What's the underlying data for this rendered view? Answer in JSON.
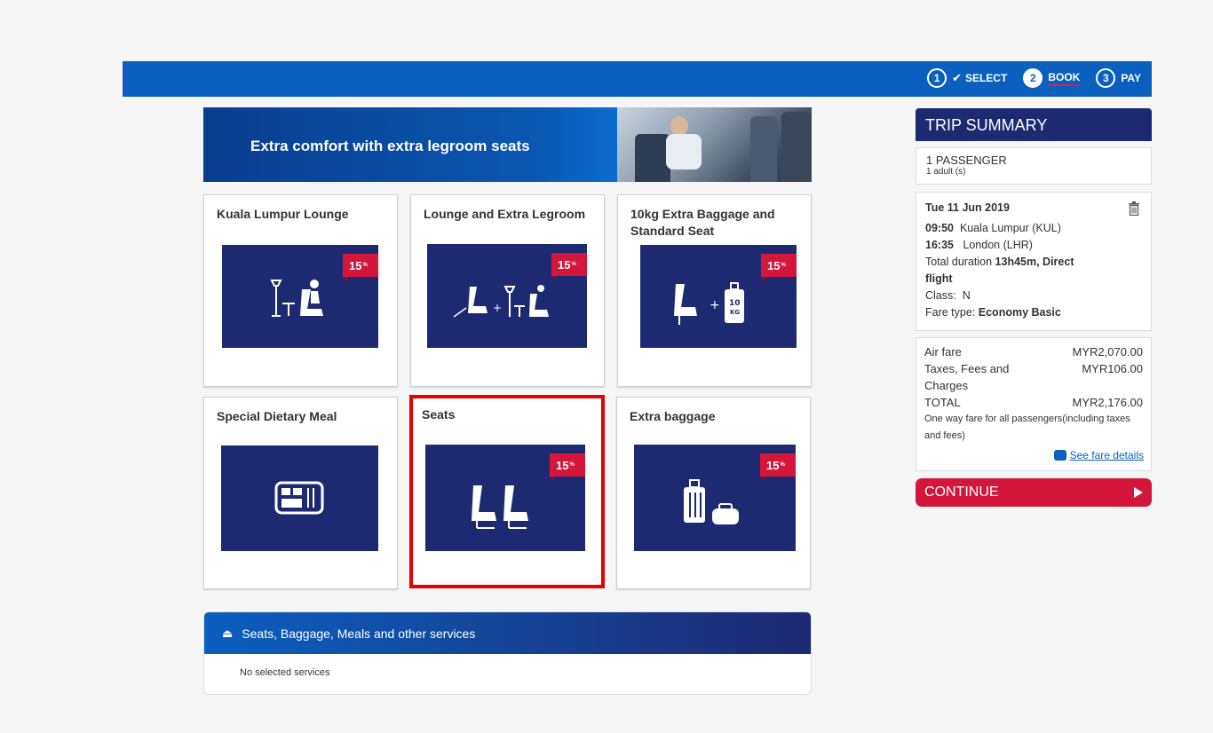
{
  "steps": [
    {
      "num": "1",
      "label": "SELECT",
      "done": true
    },
    {
      "num": "2",
      "label": "BOOK",
      "active": true
    },
    {
      "num": "3",
      "label": "PAY"
    }
  ],
  "banner": {
    "text": "Extra comfort with extra legroom seats"
  },
  "cards": [
    {
      "title": "Kuala Lumpur Lounge",
      "badge": "15",
      "icon": "lounge-icon"
    },
    {
      "title": "Lounge and Extra Legroom",
      "badge": "15",
      "icon": "lounge-legroom-icon"
    },
    {
      "title": "10kg Extra Baggage and Standard Seat",
      "badge": "15",
      "icon": "seat-baggage-icon",
      "bag_weight": "10",
      "bag_unit": "KG"
    },
    {
      "title": "Special Dietary Meal",
      "icon": "meal-tray-icon"
    },
    {
      "title": "Seats",
      "badge": "15",
      "icon": "seats-icon",
      "selected": true
    },
    {
      "title": "Extra baggage",
      "badge": "15",
      "icon": "luggage-icon"
    }
  ],
  "badge_suffix": {
    "percent": "%",
    "off": "OFF"
  },
  "services": {
    "title": "Seats, Baggage, Meals and other services",
    "empty": "No selected services"
  },
  "summary": {
    "title": "TRIP SUMMARY",
    "passengers": "1 PASSENGER",
    "adults": "1 adult (s)",
    "date": "Tue 11 Jun 2019",
    "dep_time": "09:50",
    "dep_place": "Kuala Lumpur (KUL)",
    "arr_time": "16:35",
    "arr_place": "London (LHR)",
    "duration_label": "Total  duration",
    "duration_value": "13h45m, Direct flight",
    "class_label": "Class:",
    "class_value": "N",
    "fare_type_label": "Fare type:",
    "fare_type_value": "Economy Basic",
    "air_fare_label": "Air fare",
    "air_fare_value": "MYR2,070.00",
    "taxes_label": "Taxes, Fees and Charges",
    "taxes_value": "MYR106.00",
    "total_label": "TOTAL",
    "total_value": "MYR2,176.00",
    "note": "One way fare for all passengers(including taxes and fees)",
    "fare_link": "See fare details",
    "continue": "CONTINUE"
  },
  "colors": {
    "brand_blue": "#0b5fbf",
    "navy": "#1d2a72",
    "red": "#d4163a",
    "selected_border": "#e60000"
  }
}
